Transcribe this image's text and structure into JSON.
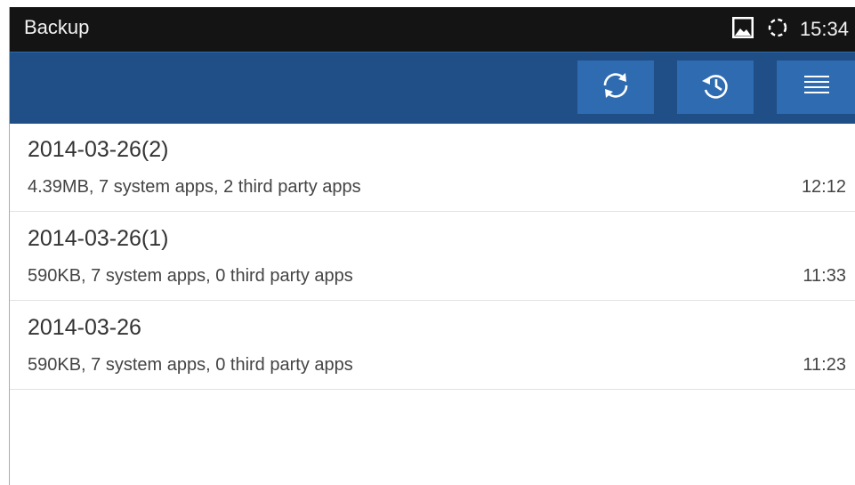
{
  "status_bar": {
    "app_title": "Backup",
    "clock": "15:34",
    "icons": [
      "image-notification-icon",
      "sync-indicator-icon"
    ]
  },
  "action_bar": {
    "buttons": [
      {
        "name": "refresh",
        "icon": "refresh-icon"
      },
      {
        "name": "restore",
        "icon": "restore-history-icon"
      },
      {
        "name": "menu",
        "icon": "menu-icon"
      }
    ]
  },
  "colors": {
    "status_bar_bg": "#141414",
    "action_bar_bg": "#1f4f86",
    "action_button_bg": "#2e6bb0",
    "divider": "#e2e2e2"
  },
  "backups": [
    {
      "title": "2014-03-26(2)",
      "details": "4.39MB, 7 system apps, 2 third party apps",
      "time": "12:12"
    },
    {
      "title": "2014-03-26(1)",
      "details": "590KB, 7 system apps, 0 third party apps",
      "time": "11:33"
    },
    {
      "title": "2014-03-26",
      "details": "590KB, 7 system apps, 0 third party apps",
      "time": "11:23"
    }
  ]
}
